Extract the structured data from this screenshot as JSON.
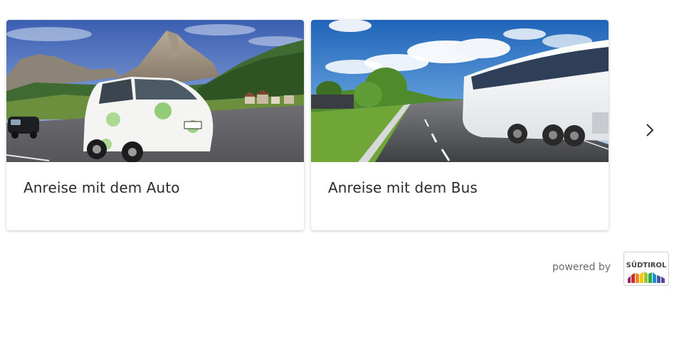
{
  "cards": [
    {
      "title": "Anreise mit dem Auto",
      "image": "mountain-road-electric-car-photo"
    },
    {
      "title": "Anreise mit dem Bus",
      "image": "highway-coach-bus-photo"
    }
  ],
  "carousel": {
    "next_icon": "chevron-right-icon"
  },
  "footer": {
    "powered_by": "powered by",
    "logo_text": "SÜDTIROL"
  }
}
